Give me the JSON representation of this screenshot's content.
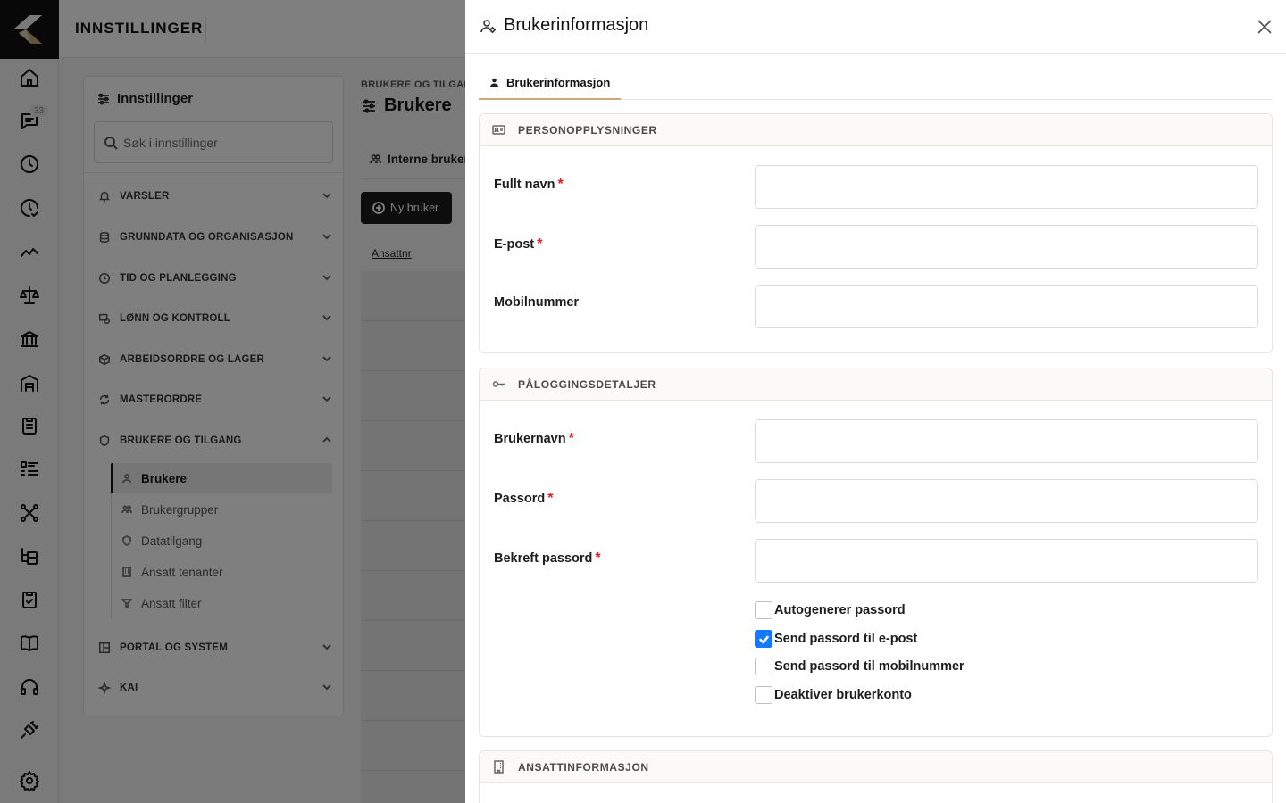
{
  "topbar": {
    "title": "INNSTILLINGER"
  },
  "rail": {
    "messages_badge": "33"
  },
  "settings": {
    "title": "Innstillinger",
    "search_placeholder": "Søk i innstillinger",
    "sections": [
      {
        "label": "VARSLER",
        "icon": "bell-icon"
      },
      {
        "label": "GRUNNDATA OG ORGANISASJON",
        "icon": "database-icon"
      },
      {
        "label": "TID OG PLANLEGGING",
        "icon": "clock-icon"
      },
      {
        "label": "LØNN OG KONTROLL",
        "icon": "payroll-icon"
      },
      {
        "label": "ARBEIDSORDRE OG LAGER",
        "icon": "box-icon"
      },
      {
        "label": "MASTERORDRE",
        "icon": "refresh-icon"
      },
      {
        "label": "BRUKERE OG TILGANG",
        "icon": "shield-icon"
      },
      {
        "label": "PORTAL OG SYSTEM",
        "icon": "layout-icon"
      },
      {
        "label": "KAI",
        "icon": "sparkle-icon"
      }
    ],
    "sub_items": [
      {
        "label": "Brukere",
        "icon": "user-icon"
      },
      {
        "label": "Brukergrupper",
        "icon": "users-icon"
      },
      {
        "label": "Datatilgang",
        "icon": "shield-icon"
      },
      {
        "label": "Ansatt tenanter",
        "icon": "building-icon"
      },
      {
        "label": "Ansatt filter",
        "icon": "filter-icon"
      }
    ]
  },
  "main": {
    "breadcrumb": "BRUKERE OG TILGANG",
    "title": "Brukere",
    "tab": "Interne brukere",
    "new_button": "Ny bruker",
    "column": "Ansattnr"
  },
  "drawer": {
    "title": "Brukerinformasjon",
    "tab": "Brukerinformasjon",
    "sections": {
      "personal": "PERSONOPPLYSNINGER",
      "login": "PÅLOGGINGSDETALJER",
      "employee": "ANSATTINFORMASJON"
    },
    "fields": {
      "full_name": {
        "label": "Fullt navn",
        "value": ""
      },
      "email": {
        "label": "E-post",
        "value": ""
      },
      "mobile": {
        "label": "Mobilnummer",
        "value": ""
      },
      "username": {
        "label": "Brukernavn",
        "value": ""
      },
      "password": {
        "label": "Passord",
        "value": ""
      },
      "confirm_password": {
        "label": "Bekreft passord",
        "value": ""
      }
    },
    "required_mark": "*",
    "checkboxes": [
      {
        "label": "Autogenerer passord",
        "checked": false
      },
      {
        "label": "Send passord til e-post",
        "checked": true
      },
      {
        "label": "Send passord til mobilnummer",
        "checked": false
      },
      {
        "label": "Deaktiver brukerkonto",
        "checked": false
      }
    ]
  },
  "colors": {
    "accent": "#c9a97a",
    "checkbox": "#1677ff",
    "required": "#e01c1c",
    "overlay": "rgba(0,0,0,0.5)"
  }
}
